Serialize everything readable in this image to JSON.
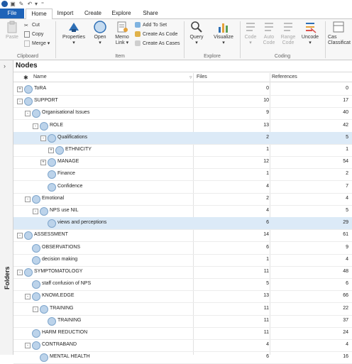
{
  "tabs": [
    "File",
    "Home",
    "Import",
    "Create",
    "Explore",
    "Share"
  ],
  "ribbon": {
    "clipboard": {
      "paste": "Paste",
      "cut": "Cut",
      "copy": "Copy",
      "merge": "Merge",
      "label": "Clipboard"
    },
    "item": {
      "properties": "Properties",
      "open": "Open",
      "memo": "Memo",
      "link": "Link",
      "add_to_set": "Add To Set",
      "create_as_code": "Create As Code",
      "create_as_cases": "Create As Cases",
      "label": "Item"
    },
    "explore": {
      "query": "Query",
      "visualize": "Visualize",
      "label": "Explore"
    },
    "coding": {
      "code": "Code",
      "auto": "Auto",
      "auto2": "Code",
      "range": "Range",
      "range2": "Code",
      "uncode": "Uncode",
      "label": "Coding"
    },
    "cases": {
      "line1": "Cas",
      "line2": "Classificat"
    }
  },
  "sidebar": {
    "label": "Folders"
  },
  "panel": {
    "title": "Nodes",
    "col_name": "Name",
    "col_files": "Files",
    "col_refs": "References"
  },
  "rows": [
    {
      "name": "ToRA",
      "files": "0",
      "refs": "0"
    },
    {
      "name": "SUPPORT",
      "files": "10",
      "refs": "17"
    },
    {
      "name": "Organisational Issues",
      "files": "9",
      "refs": "40"
    },
    {
      "name": "ROLE",
      "files": "13",
      "refs": "42"
    },
    {
      "name": "Qualifications",
      "files": "2",
      "refs": "5"
    },
    {
      "name": "ETHNICITY",
      "files": "1",
      "refs": "1"
    },
    {
      "name": "MANAGE",
      "files": "12",
      "refs": "54"
    },
    {
      "name": "Finance",
      "files": "1",
      "refs": "2"
    },
    {
      "name": "Confidence",
      "files": "4",
      "refs": "7"
    },
    {
      "name": "Emotional",
      "files": "2",
      "refs": "4"
    },
    {
      "name": "NPS use NIL",
      "files": "4",
      "refs": "5"
    },
    {
      "name": "views and perceptions",
      "files": "6",
      "refs": "29"
    },
    {
      "name": "ASSESSMENT",
      "files": "14",
      "refs": "61"
    },
    {
      "name": "OBSERVATIONS",
      "files": "6",
      "refs": "9"
    },
    {
      "name": "decision making",
      "files": "1",
      "refs": "4"
    },
    {
      "name": "SYMPTOMATOLOGY",
      "files": "11",
      "refs": "48"
    },
    {
      "name": "staff confusion of NPS",
      "files": "5",
      "refs": "6"
    },
    {
      "name": "KNOWLEDGE",
      "files": "13",
      "refs": "66"
    },
    {
      "name": "TRAINING",
      "files": "11",
      "refs": "22"
    },
    {
      "name": "TRAINING",
      "files": "11",
      "refs": "37"
    },
    {
      "name": "HARM REDUCTION",
      "files": "11",
      "refs": "24"
    },
    {
      "name": "CONTRABAND",
      "files": "4",
      "refs": "4"
    },
    {
      "name": "MENTAL HEALTH",
      "files": "6",
      "refs": "16"
    }
  ]
}
